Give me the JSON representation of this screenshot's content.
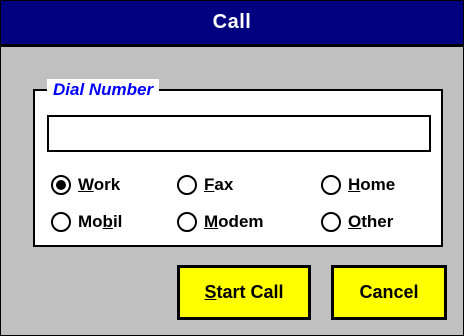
{
  "window": {
    "title": "Call"
  },
  "dial_group": {
    "legend": "Dial Number",
    "input_value": "",
    "input_placeholder": ""
  },
  "radios": [
    {
      "pre": "",
      "mnemonic": "W",
      "post": "ork",
      "checked": true
    },
    {
      "pre": "",
      "mnemonic": "F",
      "post": "ax",
      "checked": false
    },
    {
      "pre": "",
      "mnemonic": "H",
      "post": "ome",
      "checked": false
    },
    {
      "pre": "Mo",
      "mnemonic": "b",
      "post": "il",
      "checked": false
    },
    {
      "pre": "",
      "mnemonic": "M",
      "post": "odem",
      "checked": false
    },
    {
      "pre": "",
      "mnemonic": "O",
      "post": "ther",
      "checked": false
    }
  ],
  "buttons": {
    "start": {
      "pre": "",
      "mnemonic": "S",
      "post": "tart Call"
    },
    "cancel": {
      "label": "Cancel"
    }
  },
  "colors": {
    "titlebar": "#000080",
    "legend": "#0000ff",
    "button_face": "#ffff00",
    "dialog_bg": "#c0c0c0"
  }
}
